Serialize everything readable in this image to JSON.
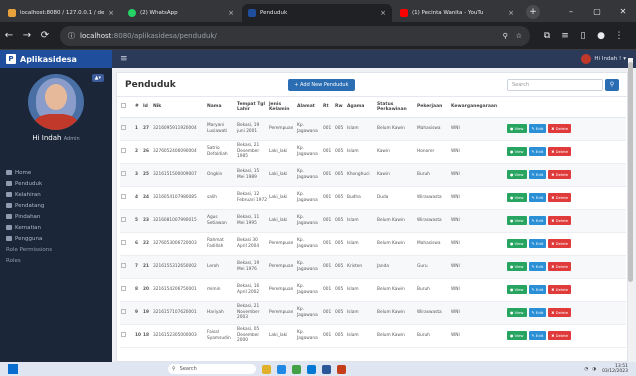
{
  "browser": {
    "tabs": [
      {
        "title": "localhost:8080 / 127.0.0.1 / de",
        "icon": "phpmyadmin-icon",
        "color": "#e8a23c"
      },
      {
        "title": "(2) WhatsApp",
        "icon": "whatsapp-icon",
        "color": "#25d366"
      },
      {
        "title": "Penduduk",
        "icon": "app-icon",
        "color": "#1f4e9c"
      },
      {
        "title": "(1) Pecinta Wanita - YouTu",
        "icon": "youtube-icon",
        "color": "#ff0000"
      }
    ],
    "url_host": "localhost",
    "url_path": ":8080/aplikasidesa/penduduk/"
  },
  "app": {
    "brand": "Aplikasidesa",
    "user_menu": "Hi Indah !"
  },
  "sidebar": {
    "profile_badge": "▲▾",
    "profile_name": "Hi Indah",
    "profile_role": "Admin",
    "items": [
      {
        "label": "Home"
      },
      {
        "label": "Penduduk"
      },
      {
        "label": "Kelahiran"
      },
      {
        "label": "Pendatang"
      },
      {
        "label": "Pindahan"
      },
      {
        "label": "Kematian"
      },
      {
        "label": "Pengguna"
      },
      {
        "label": "Role Permissions"
      },
      {
        "label": "Roles"
      }
    ]
  },
  "page": {
    "title": "Penduduk",
    "add_button": "+ Add New Penduduk",
    "search_placeholder": "Search"
  },
  "table": {
    "headers": [
      "#",
      "Id",
      "Nik",
      "Nama",
      "Tempat Tgl Lahir",
      "Jenis Kelamin",
      "Alamat",
      "Rt",
      "Rw",
      "Agama",
      "Status Perkawinan",
      "Pekerjaan",
      "Kewarganegaraan"
    ],
    "actions": {
      "view": "● View",
      "edit": "✎ Edit",
      "delete": "✖ Delete"
    },
    "rows": [
      {
        "no": "1",
        "id": "27",
        "nik": "3216095911920004",
        "nama": "Maryani Lusiawati",
        "ttl": "Bekasi, 19 juni 2001",
        "jk": "Perempuan",
        "alamat": "Kp. Jagawana",
        "rt": "001",
        "rw": "005",
        "agama": "Islam",
        "status": "Belum Kawin",
        "pekerjaan": "Mahasiswa",
        "warga": "WNI"
      },
      {
        "no": "2",
        "id": "26",
        "nik": "3276052406090004",
        "nama": "Satrio Defaldiah",
        "ttl": "Bekasi, 21 Desember 1985",
        "jk": "Laki_laki",
        "alamat": "Kp. Jagawana",
        "rt": "001",
        "rw": "005",
        "agama": "Islam",
        "status": "Kawin",
        "pekerjaan": "Honorer",
        "warga": "WNI"
      },
      {
        "no": "3",
        "id": "25",
        "nik": "3216151500009007",
        "nama": "Ongkin",
        "ttl": "Bekasi, 15 Mei 1989",
        "jk": "Laki_laki",
        "alamat": "Kp. Jagawana",
        "rt": "001",
        "rw": "005",
        "agama": "Khonghuci",
        "status": "Kawin",
        "pekerjaan": "Buruh",
        "warga": "WNI"
      },
      {
        "no": "4",
        "id": "24",
        "nik": "3216054107980085",
        "nama": "salih",
        "ttl": "Bekasi, 12 Februari 1972",
        "jk": "Laki_laki",
        "alamat": "Kp. Jagawana",
        "rt": "001",
        "rw": "005",
        "agama": "Budha",
        "status": "Duda",
        "pekerjaan": "Wiraswasta",
        "warga": "WNI"
      },
      {
        "no": "5",
        "id": "23",
        "nik": "3216081007990015",
        "nama": "Agus Setiawan",
        "ttl": "Bekasi, 11 Mei 1995",
        "jk": "Laki_laki",
        "alamat": "Kp. Jagawana",
        "rt": "001",
        "rw": "005",
        "agama": "Islam",
        "status": "Belum Kawin",
        "pekerjaan": "Wiraswasta",
        "warga": "WNI"
      },
      {
        "no": "6",
        "id": "22",
        "nik": "3276053006720003",
        "nama": "Rahmat Fadillah",
        "ttl": "Bekasi 30 April 2004",
        "jk": "Perempuan",
        "alamat": "Kp. Jagawana",
        "rt": "001",
        "rw": "005",
        "agama": "Islam",
        "status": "Belum Kawin",
        "pekerjaan": "Mahasiswa",
        "warga": "WNI"
      },
      {
        "no": "7",
        "id": "21",
        "nik": "3216155312650002",
        "nama": "Leroh",
        "ttl": "Bekasi, 19 Mei 1976",
        "jk": "Perempuan",
        "alamat": "Kp. Jagawana",
        "rt": "001",
        "rw": "005",
        "agama": "Kristen",
        "status": "Janda",
        "pekerjaan": "Guru",
        "warga": "WNI"
      },
      {
        "no": "8",
        "id": "20",
        "nik": "3216154206750001",
        "nama": "mimin",
        "ttl": "Bekasi, 16 April 2002",
        "jk": "Perempuan",
        "alamat": "Kp. Jagawana",
        "rt": "001",
        "rw": "005",
        "agama": "Islam",
        "status": "Belum Kawin",
        "pekerjaan": "Buruh",
        "warga": "WNI"
      },
      {
        "no": "9",
        "id": "19",
        "nik": "3216157107620001",
        "nama": "Hariyah",
        "ttl": "Bekasi, 21 November 2003",
        "jk": "Perempuan",
        "alamat": "Kp. Jagawana",
        "rt": "001",
        "rw": "005",
        "agama": "Islam",
        "status": "Belum Kawin",
        "pekerjaan": "Wiraswasta",
        "warga": "WNI"
      },
      {
        "no": "10",
        "id": "18",
        "nik": "3216152305000003",
        "nama": "Faisal Syamsudin",
        "ttl": "Bekasi, 05 Desember 2000",
        "jk": "Laki_laki",
        "alamat": "Kp. Jagawana",
        "rt": "001",
        "rw": "005",
        "agama": "Islam",
        "status": "Belum Kawin",
        "pekerjaan": "Buruh",
        "warga": "WNI"
      }
    ]
  },
  "taskbar": {
    "search_placeholder": "Search",
    "time": "13:51",
    "date": "03/12/2023"
  }
}
